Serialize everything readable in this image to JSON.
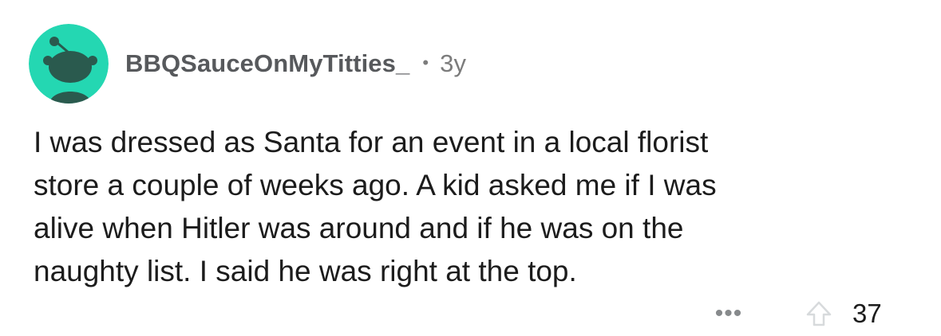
{
  "comment": {
    "author": "BBQSauceOnMyTitties_",
    "separator": "•",
    "age": "3y",
    "body": "I was dressed as Santa for an event in a local florist\nstore a couple of weeks ago. A kid asked me if I was\nalive when Hitler was around and if he was on the\nnaughty list. I said he was right at the top.",
    "more_label": "•••",
    "score": "37"
  },
  "icons": {
    "avatar": "snoo-avatar-icon",
    "more": "more-options-icon",
    "upvote": "upvote-arrow-icon"
  },
  "colors": {
    "avatar_bg": "#24d7b2",
    "avatar_figure": "#2a5a4e",
    "username": "#57595c",
    "meta": "#7c7c7c",
    "body_text": "#1c1c1c",
    "icon_gray": "#878a8c"
  }
}
